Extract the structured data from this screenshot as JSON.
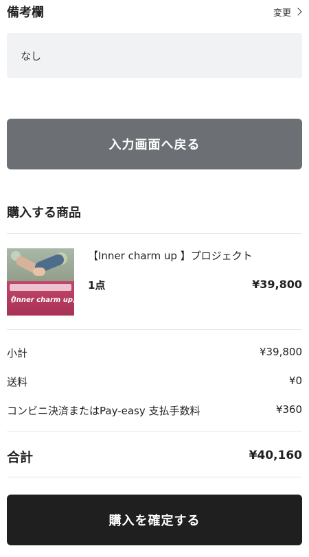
{
  "memo": {
    "title": "備考欄",
    "change_label": "変更",
    "value": "なし"
  },
  "back_button_label": "入力画面へ戻る",
  "items_section": {
    "title": "購入する商品",
    "items": [
      {
        "name": "【Inner charm up 】プロジェクト",
        "quantity": "1点",
        "price": "¥39,800",
        "thumbnail_caption": "《Inner charm up》"
      }
    ]
  },
  "summary": {
    "rows": [
      {
        "label": "小計",
        "value": "¥39,800"
      },
      {
        "label": "送料",
        "value": "¥0"
      },
      {
        "label": "コンビニ決済またはPay-easy 支払手数料",
        "value": "¥360"
      }
    ],
    "total_label": "合計",
    "total_value": "¥40,160"
  },
  "confirm_button_label": "購入を確定する",
  "colors": {
    "back_button_bg": "#6c6f74",
    "confirm_button_bg": "#1f1f1f",
    "memo_box_bg": "#f1f2f4"
  }
}
